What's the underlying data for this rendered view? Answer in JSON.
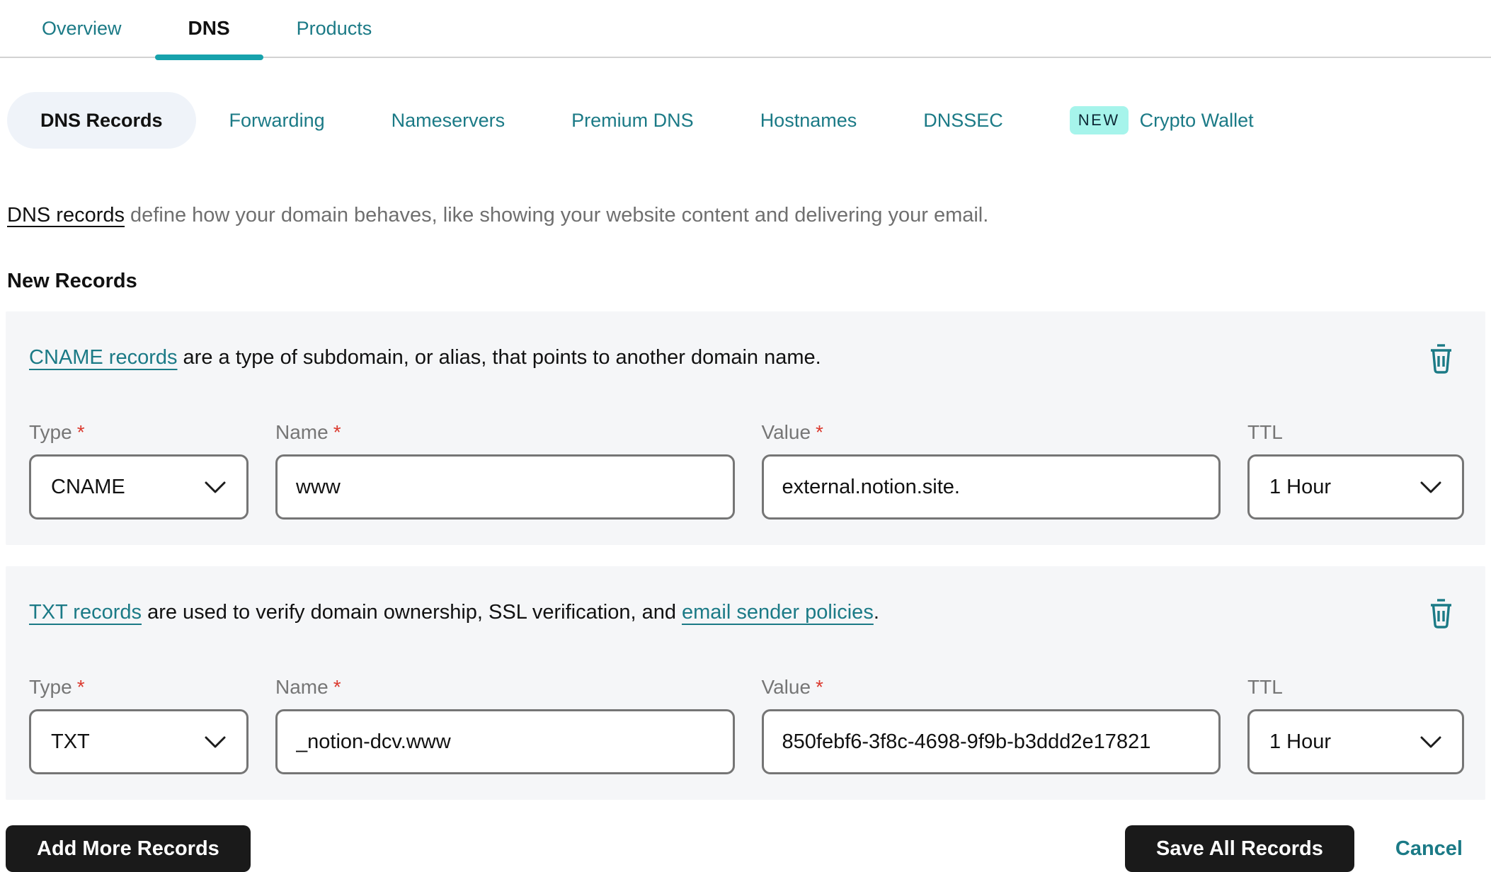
{
  "colors": {
    "accent_teal": "#1B7A86",
    "active_tab_underline": "#17A2AC",
    "new_badge_bg": "#A6F4EB",
    "card_bg": "#F5F6F8",
    "active_pill_bg": "#EFF3F9",
    "button_bg": "#1A1A1A",
    "required_red": "#DB3A2F",
    "input_border": "#757575",
    "label_gray": "#767676",
    "description_gray": "#6F6F6F"
  },
  "tabs": [
    {
      "label": "Overview",
      "active": false
    },
    {
      "label": "DNS",
      "active": true
    },
    {
      "label": "Products",
      "active": false
    }
  ],
  "subtabs": [
    {
      "label": "DNS Records",
      "active": true
    },
    {
      "label": "Forwarding",
      "active": false
    },
    {
      "label": "Nameservers",
      "active": false
    },
    {
      "label": "Premium DNS",
      "active": false
    },
    {
      "label": "Hostnames",
      "active": false
    },
    {
      "label": "DNSSEC",
      "active": false
    },
    {
      "label": "Crypto Wallet",
      "active": false,
      "badge": "NEW"
    }
  ],
  "intro": {
    "link": "DNS records",
    "text": " define how your domain behaves, like showing your website content and delivering your email."
  },
  "section_title": "New Records",
  "field_labels": {
    "type": "Type",
    "name": "Name",
    "value": "Value",
    "ttl": "TTL",
    "required": "*"
  },
  "records": [
    {
      "desc_link": "CNAME records",
      "desc_text": " are a type of subdomain, or alias, that points to another domain name.",
      "type": "CNAME",
      "name": "www",
      "value": "external.notion.site.",
      "ttl": "1 Hour"
    },
    {
      "desc_link": "TXT records",
      "desc_text": " are used to verify domain ownership, SSL verification, and ",
      "desc_link2": "email sender policies",
      "desc_suffix": ".",
      "type": "TXT",
      "name": "_notion-dcv.www",
      "value": "850febf6-3f8c-4698-9f9b-b3ddd2e17821",
      "ttl": "1 Hour"
    }
  ],
  "footer": {
    "add": "Add More Records",
    "save": "Save All Records",
    "cancel": "Cancel"
  }
}
